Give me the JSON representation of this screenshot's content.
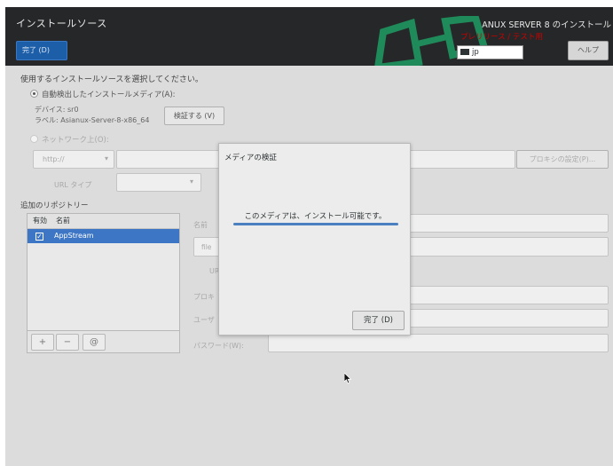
{
  "header": {
    "title": "インストールソース",
    "done_button": "完了 (D)",
    "product": "ANUX SERVER 8 のインストール",
    "prerelease": "プレリリース / テスト用",
    "keyboard_layout": "jp",
    "help_button": "ヘルプ"
  },
  "source": {
    "heading": "使用するインストールソースを選択してください。",
    "auto_media_label": "自動検出したインストールメディア(A):",
    "device": "デバイス: sr0",
    "label": "ラベル: Asianux-Server-8-x86_64",
    "verify_button": "検証する (V)",
    "network_label": "ネットワーク上(O):",
    "protocol": "http://",
    "proxy_button": "プロキシの設定(P)...",
    "url_type_label": "URL タイプ"
  },
  "repos": {
    "heading": "追加のリポジトリー",
    "col_enabled": "有効",
    "col_name": "名前",
    "items": [
      {
        "name": "AppStream",
        "enabled": true
      }
    ],
    "add": "+",
    "remove": "−",
    "reset": "@"
  },
  "repo_form": {
    "name_label": "名前",
    "file_label": "file",
    "url_label": "UR",
    "proxy_label": "プロキ",
    "user_label": "ユーザ",
    "password_label": "パスワード(W):"
  },
  "dialog": {
    "title": "メディアの検証",
    "message": "このメディアは、インストール可能です。",
    "progress": 1.0,
    "done_button": "完了 (D)"
  }
}
